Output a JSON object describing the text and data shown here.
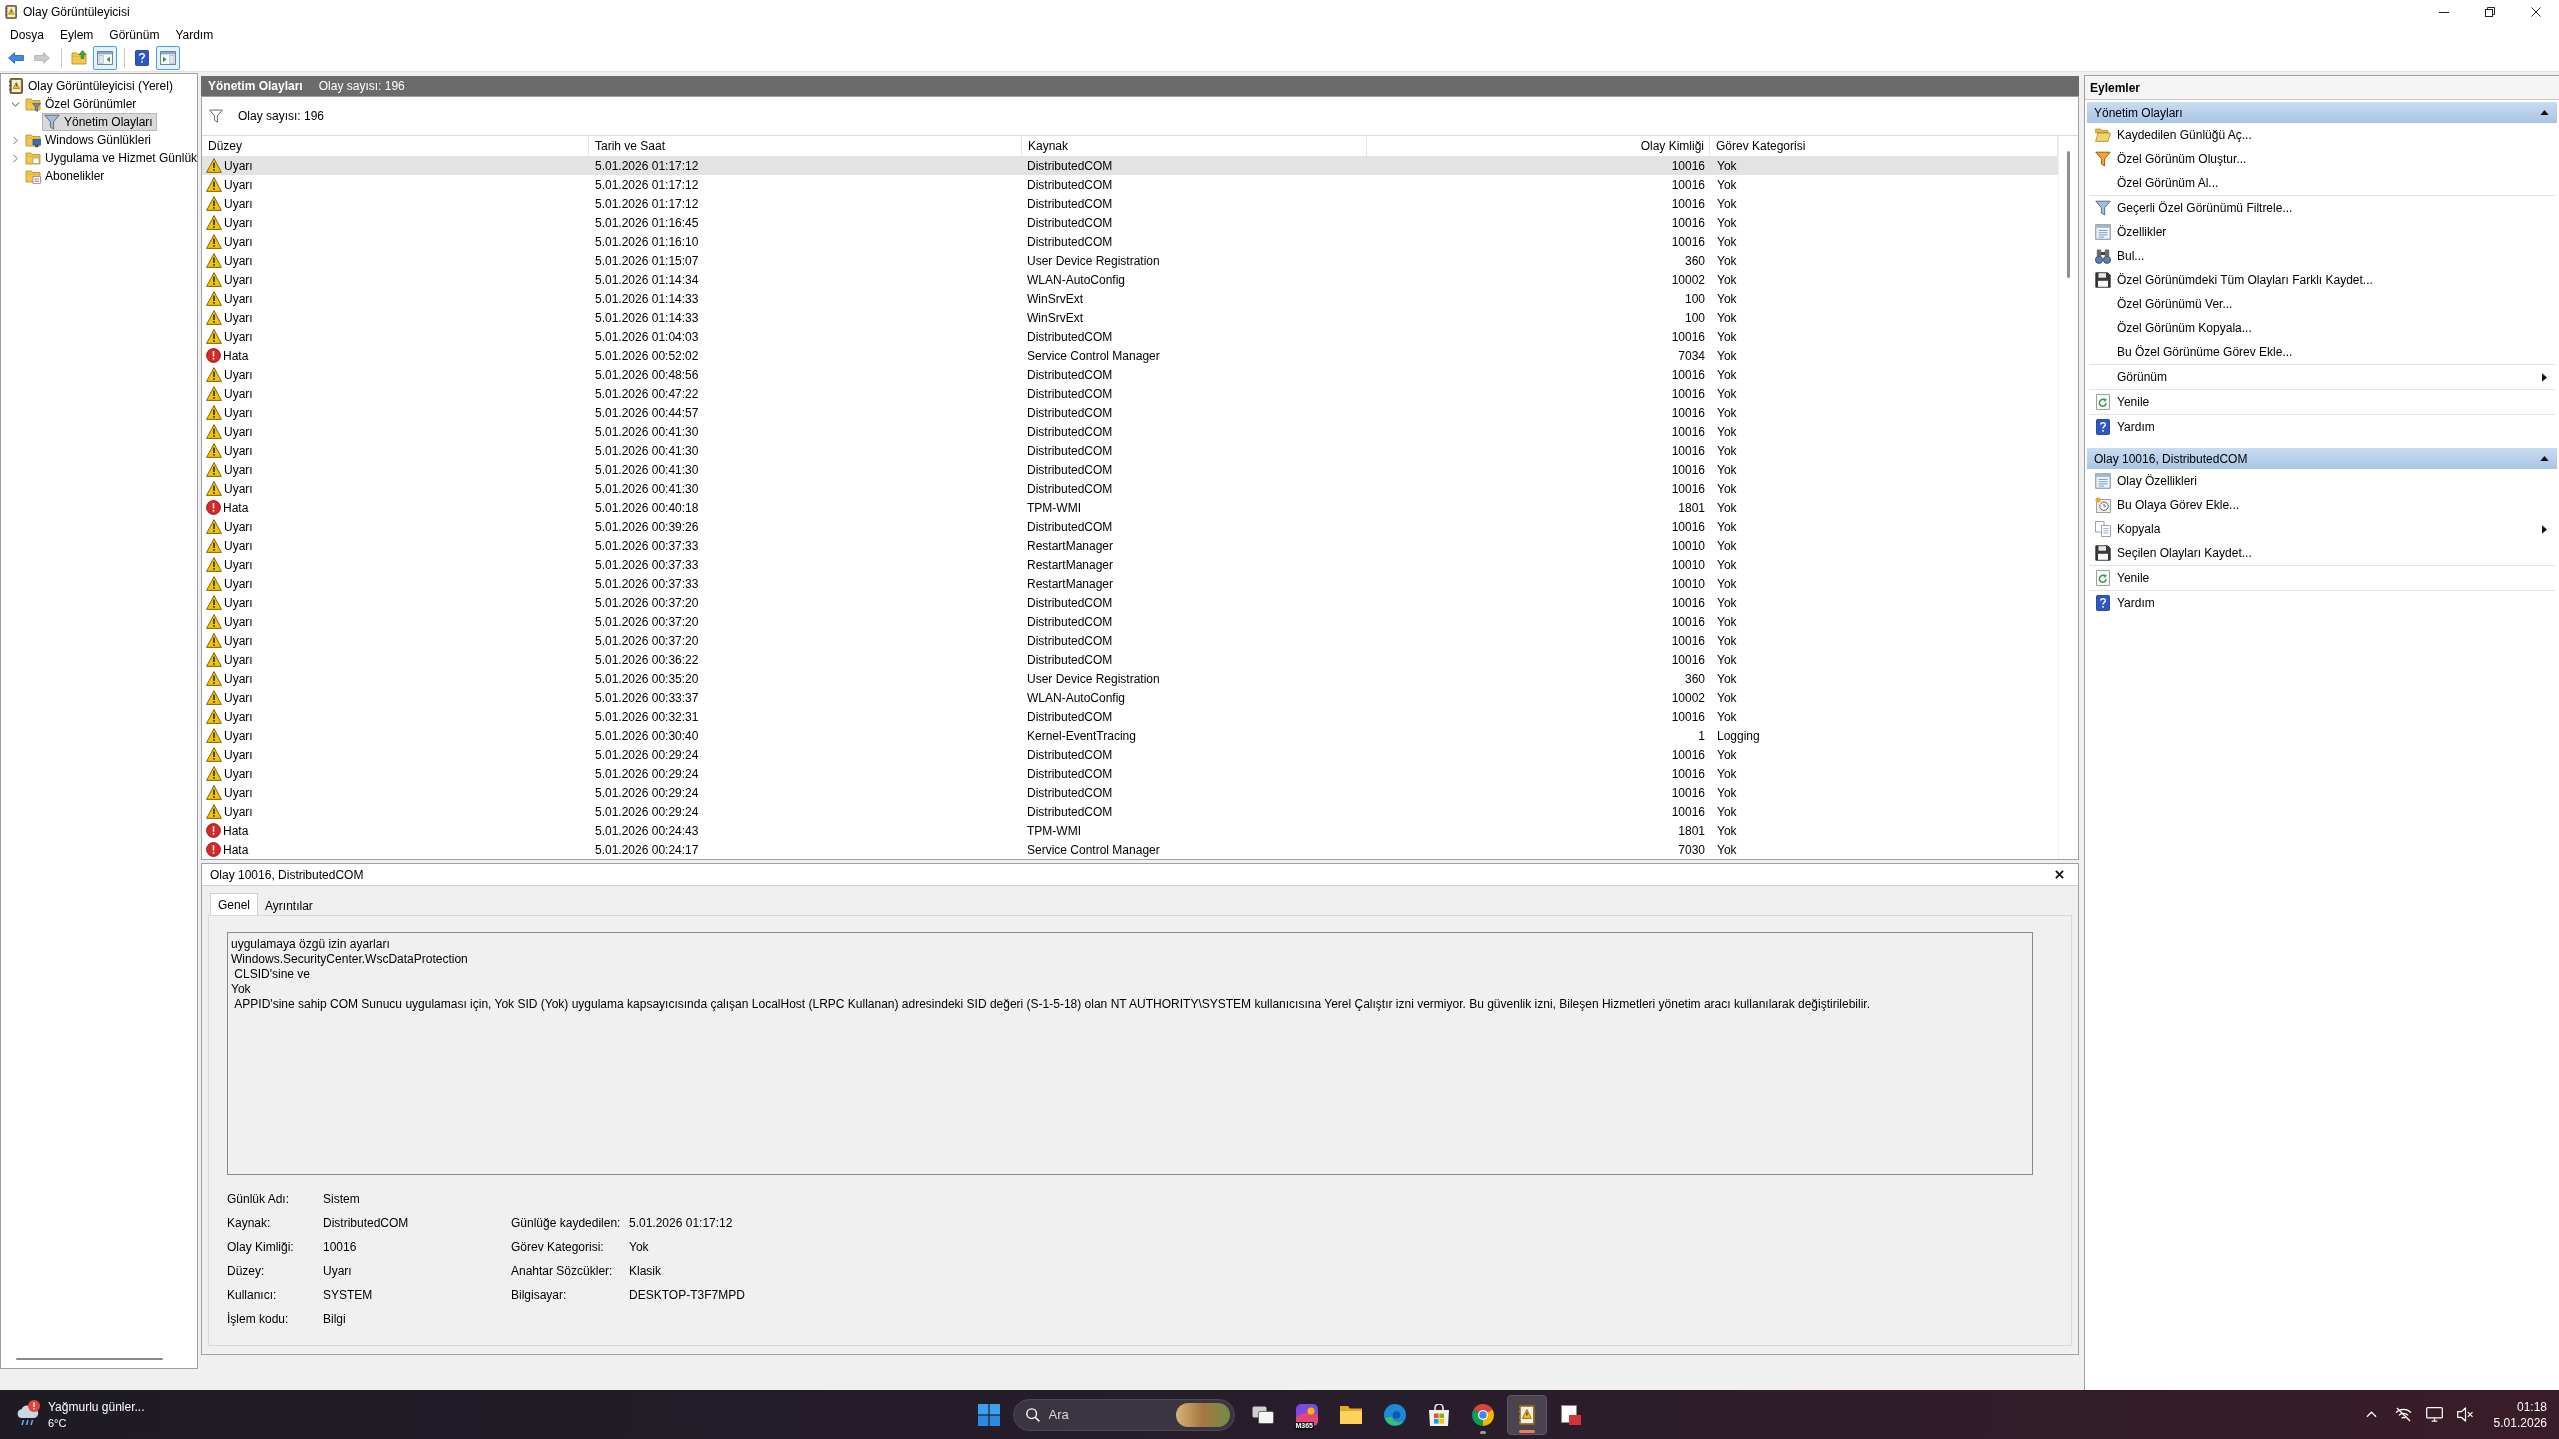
{
  "window": {
    "title": "Olay Görüntüleyicisi"
  },
  "menu": [
    "Dosya",
    "Eylem",
    "Görünüm",
    "Yardım"
  ],
  "toolbar": {
    "groups": [
      [
        {
          "kind": "back",
          "disabled": false,
          "pressed": false
        },
        {
          "kind": "forward",
          "disabled": true,
          "pressed": false
        }
      ],
      [
        {
          "kind": "up-folder",
          "disabled": false,
          "pressed": false
        },
        {
          "kind": "toggle-tree",
          "disabled": false,
          "pressed": true
        }
      ],
      [
        {
          "kind": "help",
          "disabled": false,
          "pressed": false
        },
        {
          "kind": "toggle-actions",
          "disabled": false,
          "pressed": true
        }
      ]
    ]
  },
  "tree": [
    {
      "label": "Olay Görüntüleyicisi (Yerel)",
      "kind": "viewer",
      "selected": false,
      "children": [
        {
          "label": "Özel Görünümler",
          "kind": "folder-filter",
          "expanded": true,
          "selected": false,
          "children": [
            {
              "label": "Yönetim Olayları",
              "kind": "filter",
              "selected": true
            }
          ]
        },
        {
          "label": "Windows Günlükleri",
          "kind": "folder-log",
          "expanded": false,
          "selected": false
        },
        {
          "label": "Uygulama ve Hizmet Günlük",
          "kind": "folder",
          "expanded": false,
          "selected": false
        },
        {
          "label": "Abonelikler",
          "kind": "folder-sub",
          "selected": false
        }
      ]
    }
  ],
  "events_panel": {
    "title": "Yönetim Olayları",
    "count": "Olay sayısı: 196",
    "filter_text": "Olay sayısı: 196"
  },
  "table": {
    "columns": [
      "Düzey",
      "Tarih ve Saat",
      "Kaynak",
      "Olay Kimliği",
      "Görev Kategorisi"
    ],
    "rows": [
      {
        "kind": "warning",
        "severity": "Uyarı",
        "date": "5.01.2026 01:17:12",
        "source": "DistributedCOM",
        "event_id": "10016",
        "category": "Yok",
        "selected": true
      },
      {
        "kind": "warning",
        "severity": "Uyarı",
        "date": "5.01.2026 01:17:12",
        "source": "DistributedCOM",
        "event_id": "10016",
        "category": "Yok",
        "selected": false
      },
      {
        "kind": "warning",
        "severity": "Uyarı",
        "date": "5.01.2026 01:17:12",
        "source": "DistributedCOM",
        "event_id": "10016",
        "category": "Yok",
        "selected": false
      },
      {
        "kind": "warning",
        "severity": "Uyarı",
        "date": "5.01.2026 01:16:45",
        "source": "DistributedCOM",
        "event_id": "10016",
        "category": "Yok",
        "selected": false
      },
      {
        "kind": "warning",
        "severity": "Uyarı",
        "date": "5.01.2026 01:16:10",
        "source": "DistributedCOM",
        "event_id": "10016",
        "category": "Yok",
        "selected": false
      },
      {
        "kind": "warning",
        "severity": "Uyarı",
        "date": "5.01.2026 01:15:07",
        "source": "User Device Registration",
        "event_id": "360",
        "category": "Yok",
        "selected": false
      },
      {
        "kind": "warning",
        "severity": "Uyarı",
        "date": "5.01.2026 01:14:34",
        "source": "WLAN-AutoConfig",
        "event_id": "10002",
        "category": "Yok",
        "selected": false
      },
      {
        "kind": "warning",
        "severity": "Uyarı",
        "date": "5.01.2026 01:14:33",
        "source": "WinSrvExt",
        "event_id": "100",
        "category": "Yok",
        "selected": false
      },
      {
        "kind": "warning",
        "severity": "Uyarı",
        "date": "5.01.2026 01:14:33",
        "source": "WinSrvExt",
        "event_id": "100",
        "category": "Yok",
        "selected": false
      },
      {
        "kind": "warning",
        "severity": "Uyarı",
        "date": "5.01.2026 01:04:03",
        "source": "DistributedCOM",
        "event_id": "10016",
        "category": "Yok",
        "selected": false
      },
      {
        "kind": "error",
        "severity": "Hata",
        "date": "5.01.2026 00:52:02",
        "source": "Service Control Manager",
        "event_id": "7034",
        "category": "Yok",
        "selected": false
      },
      {
        "kind": "warning",
        "severity": "Uyarı",
        "date": "5.01.2026 00:48:56",
        "source": "DistributedCOM",
        "event_id": "10016",
        "category": "Yok",
        "selected": false
      },
      {
        "kind": "warning",
        "severity": "Uyarı",
        "date": "5.01.2026 00:47:22",
        "source": "DistributedCOM",
        "event_id": "10016",
        "category": "Yok",
        "selected": false
      },
      {
        "kind": "warning",
        "severity": "Uyarı",
        "date": "5.01.2026 00:44:57",
        "source": "DistributedCOM",
        "event_id": "10016",
        "category": "Yok",
        "selected": false
      },
      {
        "kind": "warning",
        "severity": "Uyarı",
        "date": "5.01.2026 00:41:30",
        "source": "DistributedCOM",
        "event_id": "10016",
        "category": "Yok",
        "selected": false
      },
      {
        "kind": "warning",
        "severity": "Uyarı",
        "date": "5.01.2026 00:41:30",
        "source": "DistributedCOM",
        "event_id": "10016",
        "category": "Yok",
        "selected": false
      },
      {
        "kind": "warning",
        "severity": "Uyarı",
        "date": "5.01.2026 00:41:30",
        "source": "DistributedCOM",
        "event_id": "10016",
        "category": "Yok",
        "selected": false
      },
      {
        "kind": "warning",
        "severity": "Uyarı",
        "date": "5.01.2026 00:41:30",
        "source": "DistributedCOM",
        "event_id": "10016",
        "category": "Yok",
        "selected": false
      },
      {
        "kind": "error",
        "severity": "Hata",
        "date": "5.01.2026 00:40:18",
        "source": "TPM-WMI",
        "event_id": "1801",
        "category": "Yok",
        "selected": false
      },
      {
        "kind": "warning",
        "severity": "Uyarı",
        "date": "5.01.2026 00:39:26",
        "source": "DistributedCOM",
        "event_id": "10016",
        "category": "Yok",
        "selected": false
      },
      {
        "kind": "warning",
        "severity": "Uyarı",
        "date": "5.01.2026 00:37:33",
        "source": "RestartManager",
        "event_id": "10010",
        "category": "Yok",
        "selected": false
      },
      {
        "kind": "warning",
        "severity": "Uyarı",
        "date": "5.01.2026 00:37:33",
        "source": "RestartManager",
        "event_id": "10010",
        "category": "Yok",
        "selected": false
      },
      {
        "kind": "warning",
        "severity": "Uyarı",
        "date": "5.01.2026 00:37:33",
        "source": "RestartManager",
        "event_id": "10010",
        "category": "Yok",
        "selected": false
      },
      {
        "kind": "warning",
        "severity": "Uyarı",
        "date": "5.01.2026 00:37:20",
        "source": "DistributedCOM",
        "event_id": "10016",
        "category": "Yok",
        "selected": false
      },
      {
        "kind": "warning",
        "severity": "Uyarı",
        "date": "5.01.2026 00:37:20",
        "source": "DistributedCOM",
        "event_id": "10016",
        "category": "Yok",
        "selected": false
      },
      {
        "kind": "warning",
        "severity": "Uyarı",
        "date": "5.01.2026 00:37:20",
        "source": "DistributedCOM",
        "event_id": "10016",
        "category": "Yok",
        "selected": false
      },
      {
        "kind": "warning",
        "severity": "Uyarı",
        "date": "5.01.2026 00:36:22",
        "source": "DistributedCOM",
        "event_id": "10016",
        "category": "Yok",
        "selected": false
      },
      {
        "kind": "warning",
        "severity": "Uyarı",
        "date": "5.01.2026 00:35:20",
        "source": "User Device Registration",
        "event_id": "360",
        "category": "Yok",
        "selected": false
      },
      {
        "kind": "warning",
        "severity": "Uyarı",
        "date": "5.01.2026 00:33:37",
        "source": "WLAN-AutoConfig",
        "event_id": "10002",
        "category": "Yok",
        "selected": false
      },
      {
        "kind": "warning",
        "severity": "Uyarı",
        "date": "5.01.2026 00:32:31",
        "source": "DistributedCOM",
        "event_id": "10016",
        "category": "Yok",
        "selected": false
      },
      {
        "kind": "warning",
        "severity": "Uyarı",
        "date": "5.01.2026 00:30:40",
        "source": "Kernel-EventTracing",
        "event_id": "1",
        "category": "Logging",
        "selected": false
      },
      {
        "kind": "warning",
        "severity": "Uyarı",
        "date": "5.01.2026 00:29:24",
        "source": "DistributedCOM",
        "event_id": "10016",
        "category": "Yok",
        "selected": false
      },
      {
        "kind": "warning",
        "severity": "Uyarı",
        "date": "5.01.2026 00:29:24",
        "source": "DistributedCOM",
        "event_id": "10016",
        "category": "Yok",
        "selected": false
      },
      {
        "kind": "warning",
        "severity": "Uyarı",
        "date": "5.01.2026 00:29:24",
        "source": "DistributedCOM",
        "event_id": "10016",
        "category": "Yok",
        "selected": false
      },
      {
        "kind": "warning",
        "severity": "Uyarı",
        "date": "5.01.2026 00:29:24",
        "source": "DistributedCOM",
        "event_id": "10016",
        "category": "Yok",
        "selected": false
      },
      {
        "kind": "error",
        "severity": "Hata",
        "date": "5.01.2026 00:24:43",
        "source": "TPM-WMI",
        "event_id": "1801",
        "category": "Yok",
        "selected": false
      },
      {
        "kind": "error",
        "severity": "Hata",
        "date": "5.01.2026 00:24:17",
        "source": "Service Control Manager",
        "event_id": "7030",
        "category": "Yok",
        "selected": false
      }
    ]
  },
  "details": {
    "title": "Olay 10016, DistributedCOM",
    "tabs": [
      {
        "label": "Genel",
        "selected": true
      },
      {
        "label": "Ayrıntılar",
        "selected": false
      }
    ],
    "message": "uygulamaya özgü izin ayarları\nWindows.SecurityCenter.WscDataProtection\n CLSID'sine ve\nYok\n APPID'sine sahip COM Sunucu uygulaması için, Yok SID (Yok) uygulama kapsayıcısında çalışan LocalHost (LRPC Kullanan) adresindeki SID değeri (S-1-5-18) olan NT AUTHORITY\\SYSTEM kullanıcısına Yerel Çalıştır izni vermiyor. Bu güvenlik izni, Bileşen Hizmetleri yönetim aracı kullanılarak değiştirilebilir.",
    "fields_left": [
      {
        "label": "Günlük Adı:",
        "value": "Sistem"
      },
      {
        "label": "Kaynak:",
        "value": "DistributedCOM"
      },
      {
        "label": "Olay Kimliği:",
        "value": "10016"
      },
      {
        "label": "Düzey:",
        "value": "Uyarı"
      },
      {
        "label": "Kullanıcı:",
        "value": "SYSTEM"
      },
      {
        "label": "İşlem kodu:",
        "value": "Bilgi"
      }
    ],
    "fields_right": [
      {
        "label": "Günlüğe kaydedilen:",
        "value": "5.01.2026 01:17:12"
      },
      {
        "label": "Görev Kategorisi:",
        "value": "Yok"
      },
      {
        "label": "Anahtar Sözcükler:",
        "value": "Klasik"
      },
      {
        "label": "Bilgisayar:",
        "value": "DESKTOP-T3F7MPD"
      }
    ]
  },
  "actions": {
    "title": "Eylemler",
    "sections": [
      {
        "title": "Yönetim Olayları",
        "expanded": true,
        "groups": [
          [
            {
              "label": "Kaydedilen Günlüğü Aç...",
              "kind": "open-log"
            },
            {
              "label": "Özel Görünüm Oluştur...",
              "kind": "filter-new"
            },
            {
              "label": "Özel Görünüm Al...",
              "kind": "plain"
            }
          ],
          [
            {
              "label": "Geçerli Özel Görünümü Filtrele...",
              "kind": "filter"
            },
            {
              "label": "Özellikler",
              "kind": "properties"
            },
            {
              "label": "Bul...",
              "kind": "find"
            },
            {
              "label": "Özel Görünümdeki Tüm Olayları Farklı Kaydet...",
              "kind": "save"
            },
            {
              "label": "Özel Görünümü Ver...",
              "kind": "plain"
            },
            {
              "label": "Özel Görünüm Kopyala...",
              "kind": "plain"
            },
            {
              "label": "Bu Özel Görünüme Görev Ekle...",
              "kind": "plain"
            }
          ],
          [
            {
              "label": "Görünüm",
              "kind": "plain",
              "submenu": true
            }
          ],
          [
            {
              "label": "Yenile",
              "kind": "refresh"
            }
          ],
          [
            {
              "label": "Yardım",
              "kind": "help"
            }
          ]
        ]
      },
      {
        "title": "Olay 10016, DistributedCOM",
        "expanded": true,
        "groups": [
          [
            {
              "label": "Olay Özellikleri",
              "kind": "properties"
            },
            {
              "label": "Bu Olaya Görev Ekle...",
              "kind": "task"
            },
            {
              "label": "Kopyala",
              "kind": "copy",
              "submenu": true
            },
            {
              "label": "Seçilen Olayları Kaydet...",
              "kind": "save"
            }
          ],
          [
            {
              "label": "Yenile",
              "kind": "refresh"
            }
          ],
          [
            {
              "label": "Yardım",
              "kind": "help"
            }
          ]
        ]
      }
    ]
  },
  "taskbar": {
    "weather": {
      "text": "Yağmurlu günler...",
      "temperature": "6°C"
    },
    "search": {
      "placeholder": "Ara"
    },
    "apps": [
      {
        "kind": "taskview",
        "running": false,
        "active": false
      },
      {
        "kind": "tiles",
        "label": "M365",
        "running": false,
        "active": false
      },
      {
        "kind": "folder",
        "running": false,
        "active": false
      },
      {
        "kind": "swirl-browser",
        "running": false,
        "active": false
      },
      {
        "kind": "store",
        "running": false,
        "active": false
      },
      {
        "kind": "ring-browser",
        "running": true,
        "active": false
      },
      {
        "kind": "log-viewer",
        "running": true,
        "active": true
      },
      {
        "kind": "document-app",
        "running": false,
        "active": false
      }
    ],
    "clock": {
      "time": "01:18",
      "date": "5.01.2026"
    }
  }
}
